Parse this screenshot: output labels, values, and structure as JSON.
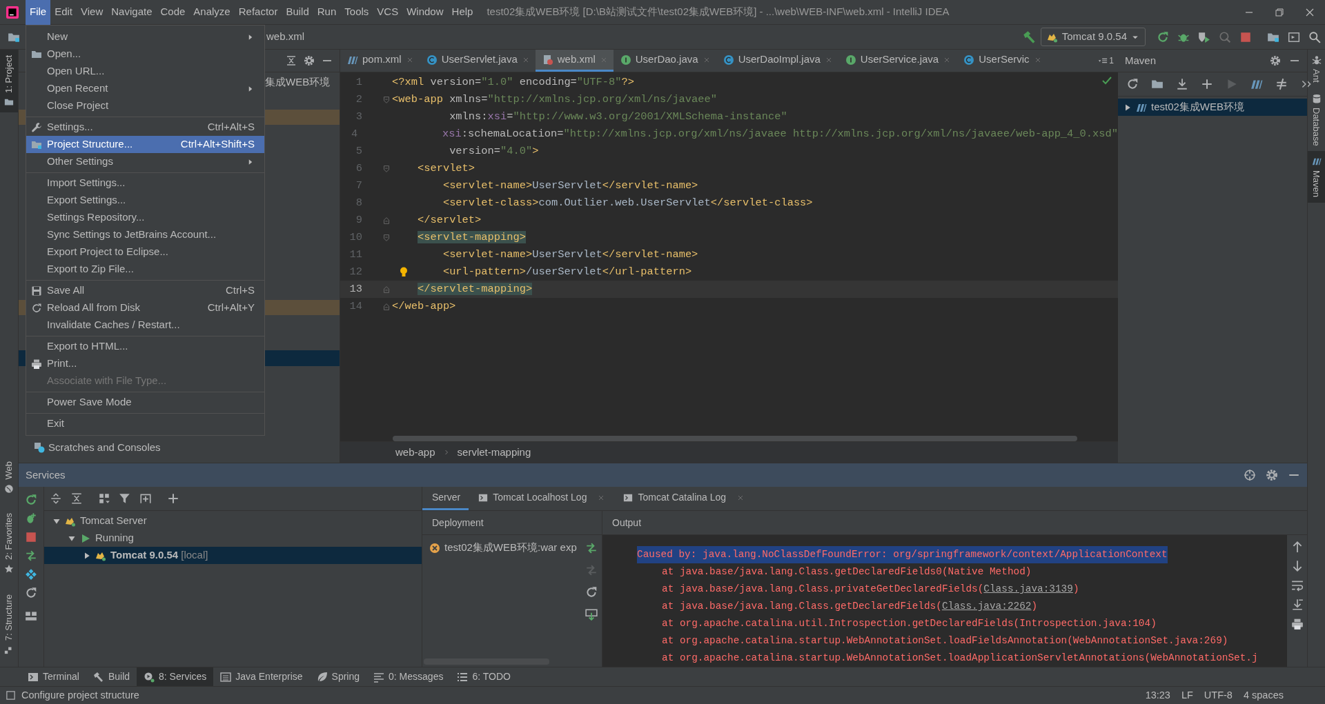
{
  "title_bar": {
    "menus": [
      {
        "label": "File",
        "selected": true
      },
      {
        "label": "Edit",
        "selected": false
      },
      {
        "label": "View",
        "selected": false
      },
      {
        "label": "Navigate",
        "selected": false
      },
      {
        "label": "Code",
        "selected": false
      },
      {
        "label": "Analyze",
        "selected": false
      },
      {
        "label": "Refactor",
        "selected": false
      },
      {
        "label": "Build",
        "selected": false
      },
      {
        "label": "Run",
        "selected": false
      },
      {
        "label": "Tools",
        "selected": false
      },
      {
        "label": "VCS",
        "selected": false
      },
      {
        "label": "Window",
        "selected": false
      },
      {
        "label": "Help",
        "selected": false
      }
    ],
    "title": "test02集成WEB环境 [D:\\B站测试文件\\test02集成WEB环境] - ...\\web\\WEB-INF\\web.xml - IntelliJ IDEA"
  },
  "navigation_bar": {
    "breadcrumb": "web.xml",
    "run_configuration": "Tomcat 9.0.54"
  },
  "file_menu": [
    {
      "kind": "item",
      "label": "New",
      "submenu": true,
      "selected": false,
      "disabled": false
    },
    {
      "kind": "item",
      "label": "Open...",
      "submenu": false,
      "selected": false,
      "disabled": false
    },
    {
      "kind": "item",
      "label": "Open URL...",
      "submenu": false,
      "selected": false,
      "disabled": false
    },
    {
      "kind": "item",
      "label": "Open Recent",
      "submenu": true,
      "selected": false,
      "disabled": false
    },
    {
      "kind": "item",
      "label": "Close Project",
      "submenu": false,
      "selected": false,
      "disabled": false
    },
    {
      "kind": "separator"
    },
    {
      "kind": "item",
      "label": "Settings...",
      "shortcut": "Ctrl+Alt+S",
      "submenu": false,
      "selected": false,
      "disabled": false
    },
    {
      "kind": "item",
      "label": "Project Structure...",
      "shortcut": "Ctrl+Alt+Shift+S",
      "submenu": false,
      "selected": true,
      "disabled": false
    },
    {
      "kind": "item",
      "label": "Other Settings",
      "submenu": true,
      "selected": false,
      "disabled": false
    },
    {
      "kind": "separator"
    },
    {
      "kind": "item",
      "label": "Import Settings...",
      "submenu": false,
      "selected": false,
      "disabled": false
    },
    {
      "kind": "item",
      "label": "Export Settings...",
      "submenu": false,
      "selected": false,
      "disabled": false
    },
    {
      "kind": "item",
      "label": "Settings Repository...",
      "submenu": false,
      "selected": false,
      "disabled": false
    },
    {
      "kind": "item",
      "label": "Sync Settings to JetBrains Account...",
      "submenu": false,
      "selected": false,
      "disabled": false
    },
    {
      "kind": "item",
      "label": "Export Project to Eclipse...",
      "submenu": false,
      "selected": false,
      "disabled": false
    },
    {
      "kind": "item",
      "label": "Export to Zip File...",
      "submenu": false,
      "selected": false,
      "disabled": false
    },
    {
      "kind": "separator"
    },
    {
      "kind": "item",
      "label": "Save All",
      "shortcut": "Ctrl+S",
      "submenu": false,
      "selected": false,
      "disabled": false
    },
    {
      "kind": "item",
      "label": "Reload All from Disk",
      "shortcut": "Ctrl+Alt+Y",
      "submenu": false,
      "selected": false,
      "disabled": false
    },
    {
      "kind": "item",
      "label": "Invalidate Caches / Restart...",
      "submenu": false,
      "selected": false,
      "disabled": false
    },
    {
      "kind": "separator"
    },
    {
      "kind": "item",
      "label": "Export to HTML...",
      "submenu": false,
      "selected": false,
      "disabled": false
    },
    {
      "kind": "item",
      "label": "Print...",
      "submenu": false,
      "selected": false,
      "disabled": false
    },
    {
      "kind": "item",
      "label": "Associate with File Type...",
      "submenu": false,
      "selected": false,
      "disabled": true
    },
    {
      "kind": "separator"
    },
    {
      "kind": "item",
      "label": "Power Save Mode",
      "submenu": false,
      "selected": false,
      "disabled": false
    },
    {
      "kind": "separator"
    },
    {
      "kind": "item",
      "label": "Exit",
      "submenu": false,
      "selected": false,
      "disabled": false
    }
  ],
  "left_stripe": [
    {
      "label": "1: Project",
      "selected": true
    },
    {
      "label": "Web",
      "selected": false
    },
    {
      "label": "2: Favorites",
      "selected": false
    },
    {
      "label": "7: Structure",
      "selected": false
    }
  ],
  "project_panel": {
    "tree": [
      {
        "label": "集成WEB环境"
      },
      {
        "label": "Scratches and Consoles"
      }
    ]
  },
  "editor": {
    "tabs": [
      {
        "label": "pom.xml",
        "kind": "maven",
        "selected": false
      },
      {
        "label": "UserServlet.java",
        "kind": "class",
        "selected": false
      },
      {
        "label": "web.xml",
        "kind": "xml",
        "selected": true
      },
      {
        "label": "UserDao.java",
        "kind": "interface",
        "selected": false
      },
      {
        "label": "UserDaoImpl.java",
        "kind": "class",
        "selected": false
      },
      {
        "label": "UserService.java",
        "kind": "interface",
        "selected": false
      },
      {
        "label": "UserServic",
        "kind": "class",
        "selected": false
      }
    ],
    "overflow_count": "1",
    "lines": [
      {
        "number": "1",
        "current": false,
        "fold_start": false,
        "fold_end": false,
        "intention": false,
        "tokens": [
          {
            "text": "<?xml",
            "kind": "tag"
          },
          {
            "text": " version=",
            "kind": "attr"
          },
          {
            "text": "\"1.0\"",
            "kind": "val"
          },
          {
            "text": " encoding=",
            "kind": "attr"
          },
          {
            "text": "\"UTF-8\"",
            "kind": "val"
          },
          {
            "text": "?>",
            "kind": "tag"
          }
        ]
      },
      {
        "number": "2",
        "current": false,
        "fold_start": true,
        "fold_end": false,
        "intention": false,
        "tokens": [
          {
            "text": "<web-app",
            "kind": "tag"
          },
          {
            "text": " xmlns=",
            "kind": "attr"
          },
          {
            "text": "\"http://xmlns.jcp.org/xml/ns/javaee\"",
            "kind": "val"
          }
        ]
      },
      {
        "number": "3",
        "current": false,
        "fold_start": false,
        "fold_end": false,
        "intention": false,
        "tokens": [
          {
            "text": "         xmlns:",
            "kind": "attr"
          },
          {
            "text": "xsi",
            "kind": "ns"
          },
          {
            "text": "=",
            "kind": "attr"
          },
          {
            "text": "\"http://www.w3.org/2001/XMLSchema-instance\"",
            "kind": "val"
          }
        ]
      },
      {
        "number": "4",
        "current": false,
        "fold_start": false,
        "fold_end": false,
        "intention": false,
        "tokens": [
          {
            "text": "         xsi",
            "kind": "ns"
          },
          {
            "text": ":schemaLocation=",
            "kind": "attr"
          },
          {
            "text": "\"http://xmlns.jcp.org/xml/ns/javaee http://xmlns.jcp.org/xml/ns/javaee/web-app_4_0.xsd\"",
            "kind": "val"
          }
        ]
      },
      {
        "number": "5",
        "current": false,
        "fold_start": false,
        "fold_end": false,
        "intention": false,
        "tokens": [
          {
            "text": "         version=",
            "kind": "attr"
          },
          {
            "text": "\"4.0\"",
            "kind": "val"
          },
          {
            "text": ">",
            "kind": "tag"
          }
        ]
      },
      {
        "number": "6",
        "current": false,
        "fold_start": true,
        "fold_end": false,
        "intention": false,
        "tokens": [
          {
            "text": "    <servlet>",
            "kind": "tag"
          }
        ]
      },
      {
        "number": "7",
        "current": false,
        "fold_start": false,
        "fold_end": false,
        "intention": false,
        "tokens": [
          {
            "text": "        <servlet-name>",
            "kind": "tag"
          },
          {
            "text": "UserServlet",
            "kind": "text"
          },
          {
            "text": "</servlet-name>",
            "kind": "tag"
          }
        ]
      },
      {
        "number": "8",
        "current": false,
        "fold_start": false,
        "fold_end": false,
        "intention": false,
        "tokens": [
          {
            "text": "        <servlet-class>",
            "kind": "tag"
          },
          {
            "text": "com.Outlier.web.UserServlet",
            "kind": "text"
          },
          {
            "text": "</servlet-class>",
            "kind": "tag"
          }
        ]
      },
      {
        "number": "9",
        "current": false,
        "fold_start": false,
        "fold_end": true,
        "intention": false,
        "tokens": [
          {
            "text": "    </servlet>",
            "kind": "tag"
          }
        ]
      },
      {
        "number": "10",
        "current": false,
        "fold_start": true,
        "fold_end": false,
        "intention": false,
        "tokens": [
          {
            "text": "    <servlet-mapping>",
            "kind": "match"
          }
        ]
      },
      {
        "number": "11",
        "current": false,
        "fold_start": false,
        "fold_end": false,
        "intention": false,
        "tokens": [
          {
            "text": "        <servlet-name>",
            "kind": "tag"
          },
          {
            "text": "UserServlet",
            "kind": "text"
          },
          {
            "text": "</servlet-name>",
            "kind": "tag"
          }
        ]
      },
      {
        "number": "12",
        "current": false,
        "fold_start": false,
        "fold_end": false,
        "intention": true,
        "tokens": [
          {
            "text": "        <url-pattern>",
            "kind": "tag"
          },
          {
            "text": "/userServlet",
            "kind": "text"
          },
          {
            "text": "</url-pattern>",
            "kind": "tag"
          }
        ]
      },
      {
        "number": "13",
        "current": true,
        "fold_start": false,
        "fold_end": true,
        "intention": false,
        "tokens": [
          {
            "text": "    </servlet-mapping>",
            "kind": "match"
          }
        ]
      },
      {
        "number": "14",
        "current": false,
        "fold_start": false,
        "fold_end": true,
        "intention": false,
        "tokens": [
          {
            "text": "</web-app>",
            "kind": "tag"
          }
        ]
      }
    ],
    "breadcrumbs": [
      "web-app",
      "servlet-mapping"
    ]
  },
  "maven_panel": {
    "title": "Maven",
    "tree": [
      {
        "label": "test02集成WEB环境",
        "selected": true
      }
    ]
  },
  "right_stripe": [
    {
      "label": "Ant",
      "selected": false
    },
    {
      "label": "Database",
      "selected": false
    },
    {
      "label": "Maven",
      "selected": true
    }
  ],
  "services": {
    "title": "Services",
    "tree": [
      {
        "label": "Tomcat Server",
        "expanded": true,
        "selected": false,
        "children": [
          {
            "label": "Running",
            "expanded": true,
            "selected": false,
            "children": [
              {
                "label": "Tomcat 9.0.54",
                "suffix": "[local]",
                "expanded": false,
                "selected": true
              }
            ]
          }
        ]
      }
    ],
    "tabs": [
      {
        "label": "Server",
        "kind": "server",
        "selected": true
      },
      {
        "label": "Tomcat Localhost Log",
        "kind": "log",
        "selected": false
      },
      {
        "label": "Tomcat Catalina Log",
        "kind": "log",
        "selected": false
      }
    ],
    "deployment": {
      "header": "Deployment",
      "items": [
        {
          "label": "test02集成WEB环境:war exp",
          "error": true
        }
      ]
    },
    "output": {
      "header": "Output",
      "lines": [
        {
          "kind": "cause",
          "selected": true,
          "text": "Caused by: java.lang.NoClassDefFoundError: org/springframework/context/ApplicationContext"
        },
        {
          "kind": "frame",
          "selected": false,
          "text": "at java.base/java.lang.Class.getDeclaredFields0(Native Method)"
        },
        {
          "kind": "frame",
          "selected": false,
          "text": "at java.base/java.lang.Class.privateGetDeclaredFields(",
          "link": "Class.java:3139",
          "end": ")"
        },
        {
          "kind": "frame",
          "selected": false,
          "text": "at java.base/java.lang.Class.getDeclaredFields(",
          "link": "Class.java:2262",
          "end": ")"
        },
        {
          "kind": "frame",
          "selected": false,
          "text": "at org.apache.catalina.util.Introspection.getDeclaredFields(Introspection.java:104)"
        },
        {
          "kind": "frame",
          "selected": false,
          "text": "at org.apache.catalina.startup.WebAnnotationSet.loadFieldsAnnotation(WebAnnotationSet.java:269)"
        },
        {
          "kind": "frame",
          "selected": false,
          "text": "at org.apache.catalina.startup.WebAnnotationSet.loadApplicationServletAnnotations(WebAnnotationSet.j"
        }
      ]
    }
  },
  "bottom_tabs": [
    {
      "label": "Terminal",
      "kind": "terminal",
      "selected": false
    },
    {
      "label": "Build",
      "kind": "build",
      "selected": false
    },
    {
      "label": "8: Services",
      "kind": "services",
      "selected": true
    },
    {
      "label": "Java Enterprise",
      "kind": "enterprise",
      "selected": false
    },
    {
      "label": "Spring",
      "kind": "spring",
      "selected": false
    },
    {
      "label": "0: Messages",
      "kind": "messages",
      "selected": false
    },
    {
      "label": "6: TODO",
      "kind": "todo",
      "selected": false
    }
  ],
  "status_bar": {
    "message": "Configure project structure",
    "items": [
      "13:23",
      "LF",
      "UTF-8",
      "4 spaces"
    ]
  }
}
